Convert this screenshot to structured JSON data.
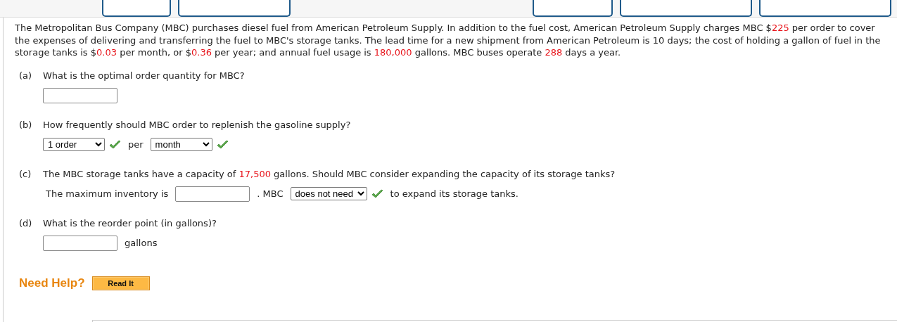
{
  "toolbar": [
    {
      "kind": "button"
    },
    {
      "kind": "button"
    },
    {
      "kind": "gap"
    },
    {
      "kind": "button"
    },
    {
      "kind": "button"
    },
    {
      "kind": "button"
    }
  ],
  "problem": [
    {
      "text": "The Metropolitan Bus Company (MBC) purchases diesel fuel from American Petroleum Supply. In addition to the fuel cost, American Petroleum Supply charges MBC $",
      "given": false
    },
    {
      "text": "225",
      "given": true
    },
    {
      "text": " per order to cover the expenses of delivering and transferring the fuel to MBC's storage tanks. The lead time for a new shipment from American Petroleum is 10 days; the cost of holding a gallon of fuel in the storage tanks is $",
      "given": false
    },
    {
      "text": "0.03",
      "given": true
    },
    {
      "text": " per month, or $",
      "given": false
    },
    {
      "text": "0.36",
      "given": true
    },
    {
      "text": " per year; and annual fuel usage is ",
      "given": false
    },
    {
      "text": "180,000",
      "given": true
    },
    {
      "text": " gallons. MBC buses operate ",
      "given": false
    },
    {
      "text": "288",
      "given": true
    },
    {
      "text": " days a year.",
      "given": false
    }
  ],
  "parts": [
    {
      "letter": "(a)",
      "question": [
        {
          "text": "What is the optimal order quantity for MBC?",
          "given": false
        }
      ],
      "answer": [
        {
          "kind": "input"
        }
      ]
    },
    {
      "letter": "(b)",
      "question": [
        {
          "text": "How frequently should MBC order to replenish the gasoline supply?",
          "given": false
        }
      ],
      "answer": [
        {
          "kind": "select",
          "value": "1 order",
          "correct": true
        },
        {
          "kind": "text",
          "text": "per"
        },
        {
          "kind": "select",
          "value": "month",
          "correct": true
        }
      ]
    },
    {
      "letter": "(c)",
      "question": [
        {
          "text": "The MBC storage tanks have a capacity of ",
          "given": false
        },
        {
          "text": "17,500",
          "given": true
        },
        {
          "text": " gallons. Should MBC consider expanding the capacity of its storage tanks?",
          "given": false
        }
      ],
      "answer": [
        {
          "kind": "text",
          "text": "The maximum inventory is"
        },
        {
          "kind": "input"
        },
        {
          "kind": "text",
          "text": ". MBC"
        },
        {
          "kind": "select",
          "value": "does not need",
          "correct": true
        },
        {
          "kind": "text",
          "text": "to expand its storage tanks."
        }
      ]
    },
    {
      "letter": "(d)",
      "question": [
        {
          "text": "What is the reorder point (in gallons)?",
          "given": false
        }
      ],
      "answer": [
        {
          "kind": "input"
        },
        {
          "kind": "text",
          "text": "gallons"
        }
      ]
    }
  ],
  "help": {
    "label": "Need Help?",
    "button": "Read It"
  }
}
